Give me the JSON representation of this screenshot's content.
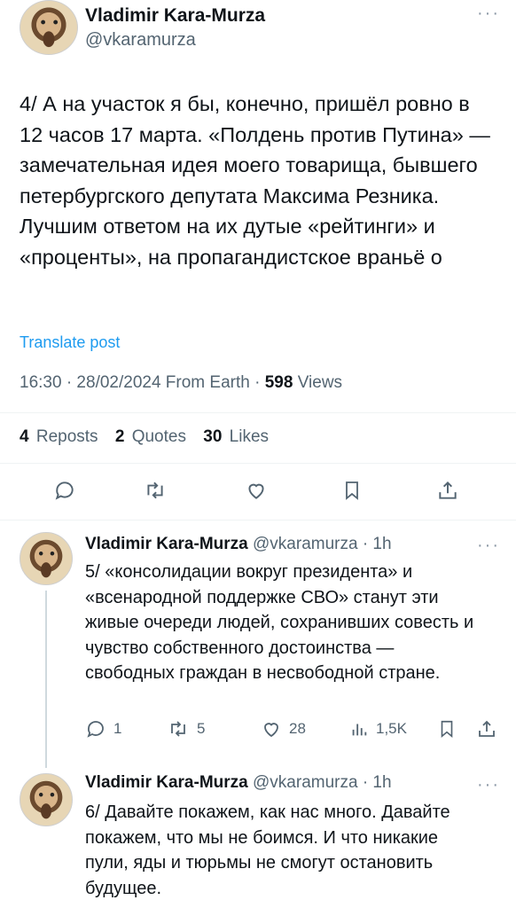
{
  "main": {
    "author_name": "Vladimir Kara-Murza",
    "author_handle": "@vkaramurza",
    "text": "4/ А на участок я бы, конечно, пришёл ровно в 12 часов 17 марта. «Полдень против Путина» — замечательная идея моего товарища, бывшего петербургского депутата Максима Резника. Лучшим ответом на их дутые «рейтинги» и «проценты», на пропагандистское враньё о",
    "translate_label": "Translate post",
    "time": "16:30 · 28/02/2024 From Earth · ",
    "views_count": "598",
    "views_label": " Views",
    "stats": {
      "reposts_count": "4",
      "reposts_label": "Reposts",
      "quotes_count": "2",
      "quotes_label": "Quotes",
      "likes_count": "30",
      "likes_label": "Likes"
    }
  },
  "replies": [
    {
      "author_name": "Vladimir Kara-Murza",
      "author_handle": "@vkaramurza · 1h",
      "text": "5/ «консолидации вокруг президента» и «всенародной поддержке СВО» станут эти живые очереди людей, сохранивших совесть и чувство собственного достоинства — свободных граждан в несвободной стране.",
      "replies_count": "1",
      "reposts_count": "5",
      "likes_count": "28",
      "views_count": "1,5K"
    },
    {
      "author_name": "Vladimir Kara-Murza",
      "author_handle": "@vkaramurza · 1h",
      "text": "6/ Давайте покажем, как нас много. Давайте покажем, что мы не боимся. И что никакие пули, яды и тюрьмы не смогут остановить будущее."
    }
  ],
  "icons": {
    "more": "more-icon",
    "reply": "reply-icon",
    "repost": "repost-icon",
    "like": "like-icon",
    "bookmark": "bookmark-icon",
    "share": "share-icon",
    "views": "views-icon"
  },
  "colors": {
    "accent": "#1d9bf0",
    "secondary_text": "#536471"
  }
}
